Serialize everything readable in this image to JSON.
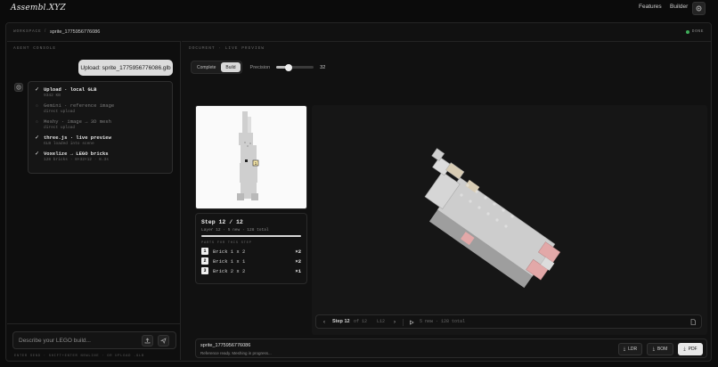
{
  "nav": {
    "logo": "Assembl.XYZ",
    "features": "Features",
    "builder": "Builder",
    "menu_icon": "menu-icon"
  },
  "workspace": {
    "label": "WORKSPACE",
    "separator": "/",
    "file": "sprite_1775956776086",
    "status": "DONE"
  },
  "console": {
    "label": "AGENT CONSOLE",
    "upload_message": "Upload: sprite_1775956776086.glb",
    "steps": [
      {
        "title": "Upload · local GLB",
        "sub": "9342 KB",
        "done": true
      },
      {
        "title": "Gemini · reference image",
        "sub": "direct upload",
        "done": false
      },
      {
        "title": "Meshy · image → 3D mesh",
        "sub": "direct upload",
        "done": false
      },
      {
        "title": "three.js · live preview",
        "sub": "GLB loaded into scene",
        "done": true
      },
      {
        "title": "Voxelize → LEGO bricks",
        "sub": "128 bricks · 8×32×12 · 8.3s",
        "done": true
      }
    ],
    "input_placeholder": "Describe your LEGO build...",
    "hint": "ENTER SEND · SHIFT+ENTER NEWLINE · OR UPLOAD .GLB"
  },
  "document": {
    "label": "DOCUMENT · LIVE PREVIEW",
    "tabs": [
      "Complete",
      "Build"
    ],
    "active_tab": "Build",
    "precision_label": "Precision",
    "precision_value": "32",
    "precision_fraction": 0.32
  },
  "step_card": {
    "title": "Step 12 / 12",
    "sub": "Layer 12 · 5 new · 128 total",
    "progress": 1.0,
    "parts_label": "PARTS FOR THIS STEP",
    "parts": [
      {
        "num": "1",
        "name": "Brick 1 x 2",
        "qty": "×2"
      },
      {
        "num": "2",
        "name": "Brick 1 x 1",
        "qty": "×2"
      },
      {
        "num": "3",
        "name": "Brick 2 x 2",
        "qty": "×1"
      }
    ]
  },
  "playbar": {
    "step_label": "Step 12",
    "of_label": "of 12",
    "layer": "L12",
    "counts": "5 new · 128 total"
  },
  "footer": {
    "name": "sprite_1775956776086",
    "status": "Reference ready. Meshing in progress...",
    "ldr": "LDR",
    "bom": "BOM",
    "pdf": "PDF"
  },
  "colors": {
    "background": "#0b0b0b",
    "done_green": "#3fae5a",
    "brick_grey": "#c9c9c9",
    "brick_pink": "#e2a8a8",
    "brick_tan": "#d8ccb4"
  }
}
